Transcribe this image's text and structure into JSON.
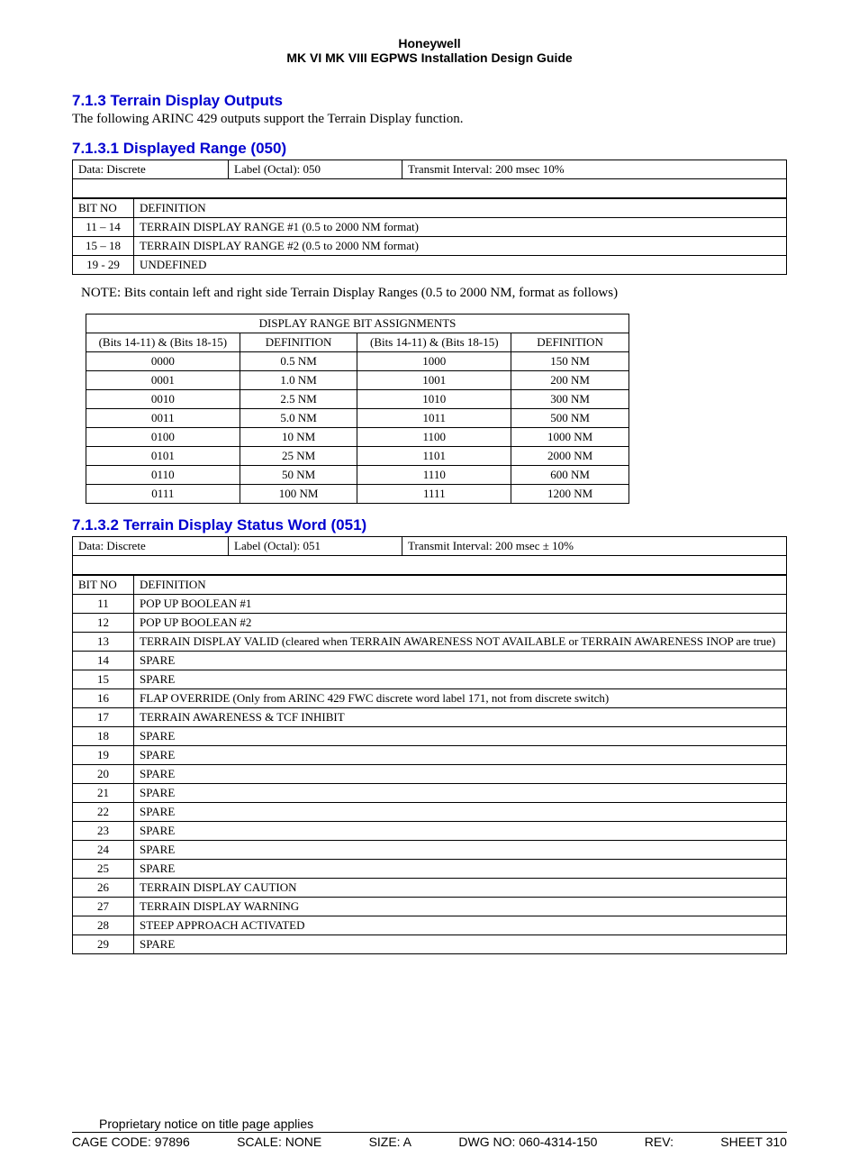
{
  "header": {
    "line1": "Honeywell",
    "line2": "MK VI  MK VIII EGPWS Installation Design Guide"
  },
  "s713": {
    "heading": "7.1.3  Terrain Display Outputs",
    "text": "The following ARINC 429 outputs support the Terrain Display function."
  },
  "s7131": {
    "heading": "7.1.3.1  Displayed Range (050)",
    "meta": {
      "data": "Data:  Discrete",
      "label": "Label (Octal):  050",
      "tx": "Transmit Interval: 200 msec      10%"
    },
    "hdr": {
      "bit": "BIT NO",
      "def": "DEFINITION"
    },
    "rows": [
      {
        "bit": "11 – 14",
        "def": "TERRAIN DISPLAY RANGE #1 (0.5 to 2000 NM format)"
      },
      {
        "bit": "15 – 18",
        "def": "TERRAIN DISPLAY RANGE #2 (0.5 to 2000 NM format)"
      },
      {
        "bit": "19 - 29",
        "def": "UNDEFINED"
      }
    ],
    "note": "NOTE:  Bits contain left and right side Terrain Display Ranges (0.5 to 2000 NM, format as follows)"
  },
  "bit_table": {
    "title": "DISPLAY RANGE BIT ASSIGNMENTS",
    "hdr": {
      "bits": "(Bits 14-11) & (Bits 18-15)",
      "def": "DEFINITION"
    },
    "rows": [
      {
        "a": "0000",
        "b": "0.5 NM",
        "c": "1000",
        "d": "150 NM"
      },
      {
        "a": "0001",
        "b": "1.0 NM",
        "c": "1001",
        "d": "200 NM"
      },
      {
        "a": "0010",
        "b": "2.5 NM",
        "c": "1010",
        "d": "300 NM"
      },
      {
        "a": "0011",
        "b": "5.0 NM",
        "c": "1011",
        "d": "500 NM"
      },
      {
        "a": "0100",
        "b": "10 NM",
        "c": "1100",
        "d": "1000 NM"
      },
      {
        "a": "0101",
        "b": "25 NM",
        "c": "1101",
        "d": "2000 NM"
      },
      {
        "a": "0110",
        "b": "50 NM",
        "c": "1110",
        "d": "600 NM"
      },
      {
        "a": "0111",
        "b": "100 NM",
        "c": "1111",
        "d": "1200 NM"
      }
    ]
  },
  "s7132": {
    "heading": "7.1.3.2  Terrain Display Status Word (051)",
    "meta": {
      "data": "Data:  Discrete",
      "label": "Label (Octal):  051",
      "tx": "Transmit Interval:  200 msec ± 10%"
    },
    "hdr": {
      "bit": "BIT NO",
      "def": "DEFINITION"
    },
    "rows": [
      {
        "bit": "11",
        "def": "POP UP BOOLEAN #1"
      },
      {
        "bit": "12",
        "def": "POP UP BOOLEAN #2"
      },
      {
        "bit": "13",
        "def": "TERRAIN DISPLAY VALID (cleared when TERRAIN AWARENESS NOT AVAILABLE or TERRAIN AWARENESS INOP are true)"
      },
      {
        "bit": "14",
        "def": " SPARE"
      },
      {
        "bit": "15",
        "def": " SPARE"
      },
      {
        "bit": "16",
        "def": "FLAP OVERRIDE (Only from ARINC 429 FWC discrete  word label 171, not from discrete switch)"
      },
      {
        "bit": "17",
        "def": "TERRAIN AWARENESS & TCF INHIBIT"
      },
      {
        "bit": "18",
        "def": " SPARE"
      },
      {
        "bit": "19",
        "def": " SPARE"
      },
      {
        "bit": "20",
        "def": " SPARE"
      },
      {
        "bit": "21",
        "def": " SPARE"
      },
      {
        "bit": "22",
        "def": " SPARE"
      },
      {
        "bit": "23",
        "def": " SPARE"
      },
      {
        "bit": "24",
        "def": " SPARE"
      },
      {
        "bit": "25",
        "def": " SPARE"
      },
      {
        "bit": "26",
        "def": "TERRAIN DISPLAY CAUTION"
      },
      {
        "bit": "27",
        "def": "TERRAIN DISPLAY WARNING"
      },
      {
        "bit": "28",
        "def": "STEEP APPROACH ACTIVATED"
      },
      {
        "bit": "29",
        "def": " SPARE"
      }
    ]
  },
  "footer": {
    "notice": "Proprietary notice on title page applies",
    "cage": "CAGE CODE: 97896",
    "scale": "SCALE: NONE",
    "size": "SIZE: A",
    "dwg": "DWG NO: 060-4314-150",
    "rev": "REV:",
    "sheet": "SHEET 310"
  }
}
